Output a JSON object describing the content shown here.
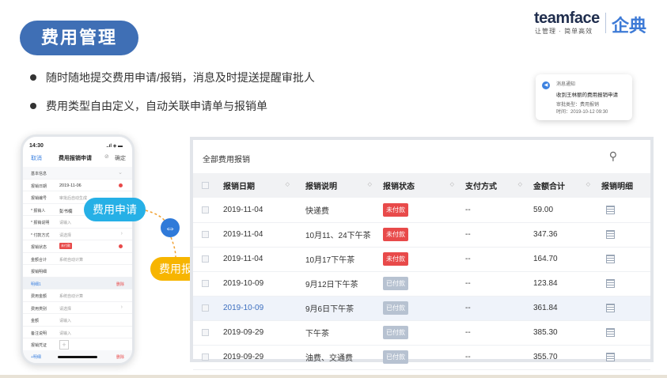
{
  "header": {
    "title": "费用管理",
    "logo_word": "teamface",
    "logo_slogan": "让管理 · 简单高效",
    "logo_cn": "企典"
  },
  "bullets": [
    "随时随地提交费用申请/报销，消息及时提送提醒审批人",
    "费用类型自由定义，自动关联申请单与报销单"
  ],
  "notification": {
    "heading": "消息通知",
    "title": "收到王林丽的费用报销申请",
    "line1": "审批类型：费用报销",
    "line2": "时间：2019-10-12  09:30"
  },
  "phone": {
    "time": "14:30",
    "signal": "..ıl ◈ ▬",
    "cancel": "取消",
    "title": "费用报销申请",
    "confirm": "确定",
    "rows": [
      {
        "k": "基本信息",
        "v": "",
        "type": "head"
      },
      {
        "k": "报销日期",
        "v": "2019-11-06",
        "type": "dark-req"
      },
      {
        "k": "报销编号",
        "v": "审批后自动生成",
        "type": "plain"
      },
      {
        "k": "* 报销人",
        "v": "彭书楠",
        "type": "dark"
      },
      {
        "k": "* 报销说明",
        "v": "请输入",
        "type": "plain"
      },
      {
        "k": "* 付款方式",
        "v": "请选择",
        "type": "arrow"
      },
      {
        "k": "报销状态",
        "v": "未付款",
        "type": "tag-req"
      },
      {
        "k": "金额合计",
        "v": "系统自动计算",
        "type": "plain"
      },
      {
        "k": "报销明细",
        "v": "",
        "type": "plain"
      },
      {
        "k": "明细1",
        "v": "删除",
        "type": "detail"
      },
      {
        "k": "费用金额",
        "v": "系统自动计算",
        "type": "plain"
      },
      {
        "k": "费用类别",
        "v": "请选择",
        "type": "arrow"
      },
      {
        "k": "金额",
        "v": "请输入",
        "type": "plain"
      },
      {
        "k": "备注说明",
        "v": "请输入",
        "type": "plain"
      },
      {
        "k": "报销凭证",
        "v": "+",
        "type": "plus"
      }
    ],
    "footer_add": "+明细",
    "footer_del": "删除"
  },
  "callouts": {
    "apply": "费用申请",
    "reimburse": "费用报销",
    "link_icon": "⇔"
  },
  "table": {
    "title": "全部费用报销",
    "search_icon": "search-icon",
    "columns": [
      "报销日期",
      "报销说明",
      "报销状态",
      "支付方式",
      "金额合计",
      "报销明细"
    ],
    "rows": [
      {
        "date": "2019-11-04",
        "desc": "快递费",
        "status": "未付款",
        "paid": false,
        "pay": "--",
        "amount": "59.00"
      },
      {
        "date": "2019-11-04",
        "desc": "10月11、24下午茶",
        "status": "未付款",
        "paid": false,
        "pay": "--",
        "amount": "347.36"
      },
      {
        "date": "2019-11-04",
        "desc": "10月17下午茶",
        "status": "未付款",
        "paid": false,
        "pay": "--",
        "amount": "164.70"
      },
      {
        "date": "2019-10-09",
        "desc": "9月12日下午茶",
        "status": "已付款",
        "paid": true,
        "pay": "--",
        "amount": "123.84"
      },
      {
        "date": "2019-10-09",
        "desc": "9月6日下午茶",
        "status": "已付款",
        "paid": true,
        "pay": "--",
        "amount": "361.84",
        "highlight": true
      },
      {
        "date": "2019-09-29",
        "desc": "下午茶",
        "status": "已付款",
        "paid": true,
        "pay": "--",
        "amount": "385.30"
      },
      {
        "date": "2019-09-29",
        "desc": "油费、交通费",
        "status": "已付款",
        "paid": true,
        "pay": "--",
        "amount": "355.70"
      }
    ]
  },
  "colors": {
    "title_pill": "#3f6fb5",
    "apply_pill": "#26b0e6",
    "reimburse_pill": "#f7b500",
    "unpaid": "#e84a4a",
    "paid": "#b7c2d1"
  }
}
